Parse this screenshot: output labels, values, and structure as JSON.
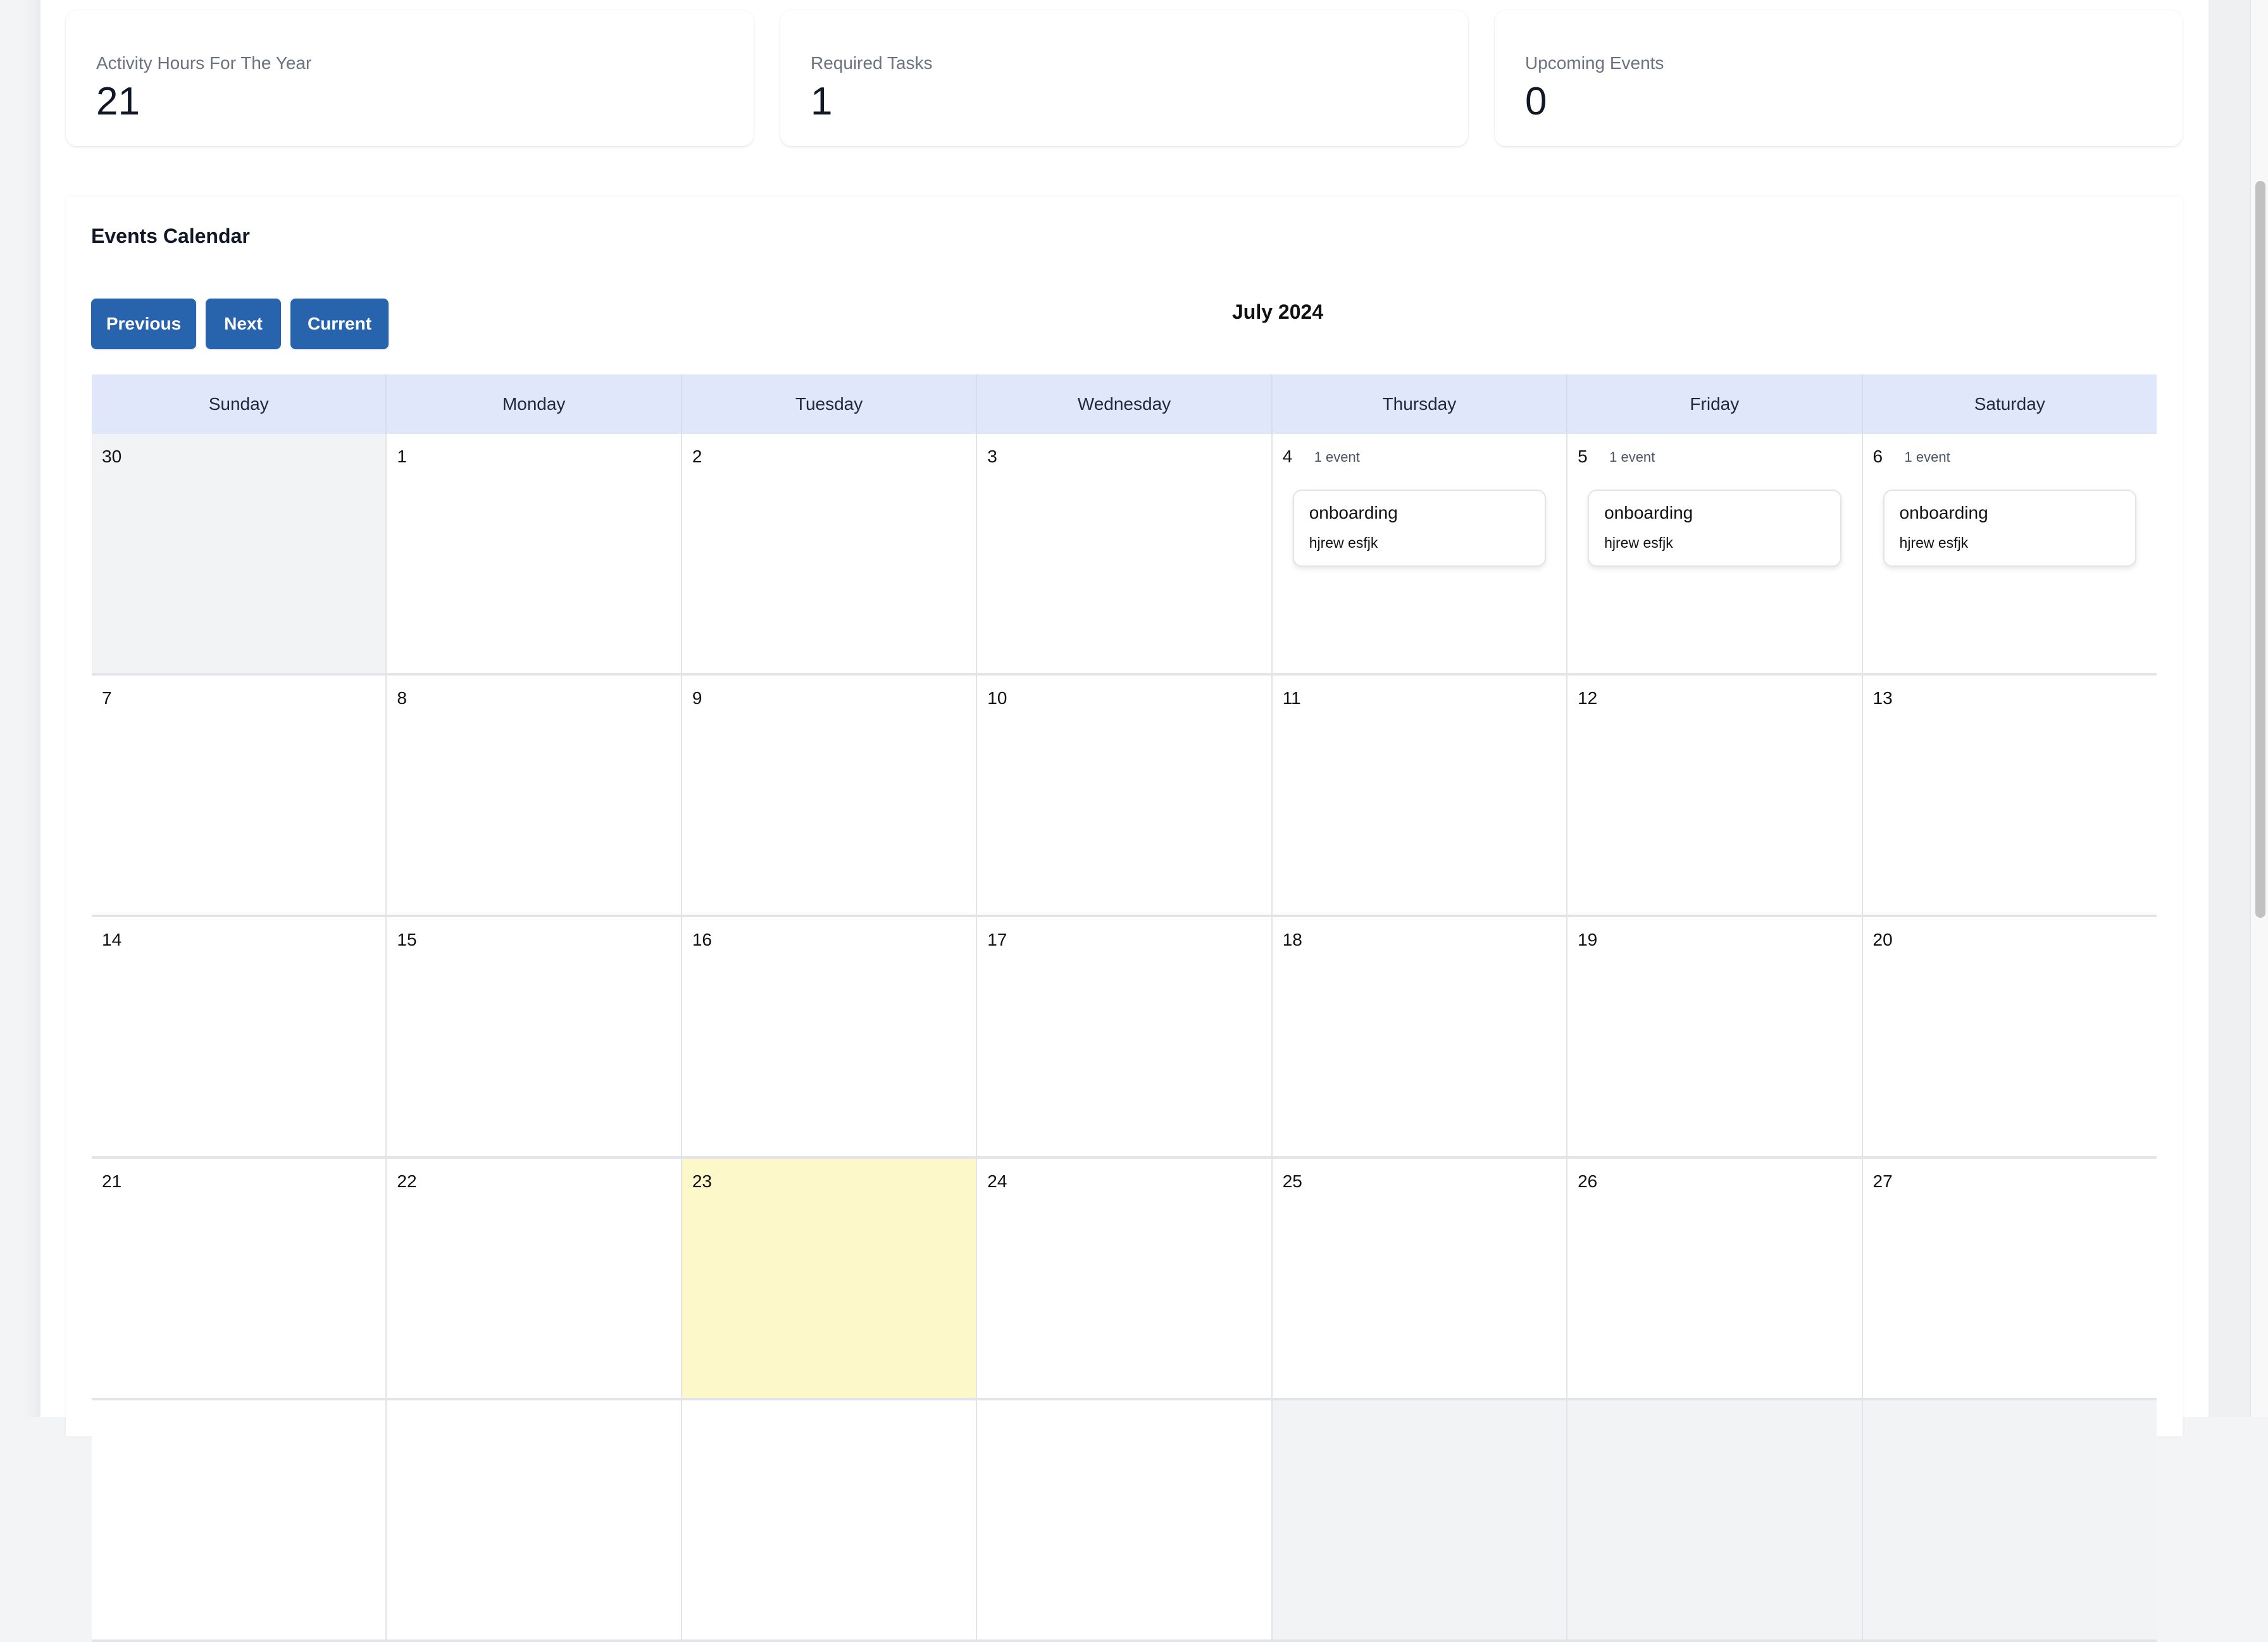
{
  "stats": [
    {
      "label": "Activity Hours For The Year",
      "value": "21"
    },
    {
      "label": "Required Tasks",
      "value": "1"
    },
    {
      "label": "Upcoming Events",
      "value": "0"
    }
  ],
  "calendar": {
    "title": "Events Calendar",
    "month_label": "July 2024",
    "buttons": {
      "previous": "Previous",
      "next": "Next",
      "current": "Current"
    },
    "weekdays": [
      "Sunday",
      "Monday",
      "Tuesday",
      "Wednesday",
      "Thursday",
      "Friday",
      "Saturday"
    ],
    "colors": {
      "header_bg": "#e0e7fb",
      "button_bg": "#2863ad",
      "today_bg": "#fcf8c9",
      "other_month_bg": "#f2f3f5"
    },
    "weeks": [
      [
        {
          "day": "30",
          "other": true
        },
        {
          "day": "1"
        },
        {
          "day": "2"
        },
        {
          "day": "3"
        },
        {
          "day": "4",
          "count": "1 event",
          "events": [
            {
              "title": "onboarding",
              "desc": "hjrew esfjk"
            }
          ]
        },
        {
          "day": "5",
          "count": "1 event",
          "events": [
            {
              "title": "onboarding",
              "desc": "hjrew esfjk"
            }
          ]
        },
        {
          "day": "6",
          "count": "1 event",
          "events": [
            {
              "title": "onboarding",
              "desc": "hjrew esfjk"
            }
          ]
        }
      ],
      [
        {
          "day": "7"
        },
        {
          "day": "8"
        },
        {
          "day": "9"
        },
        {
          "day": "10"
        },
        {
          "day": "11"
        },
        {
          "day": "12"
        },
        {
          "day": "13"
        }
      ],
      [
        {
          "day": "14"
        },
        {
          "day": "15"
        },
        {
          "day": "16"
        },
        {
          "day": "17"
        },
        {
          "day": "18"
        },
        {
          "day": "19"
        },
        {
          "day": "20"
        }
      ],
      [
        {
          "day": "21"
        },
        {
          "day": "22"
        },
        {
          "day": "23",
          "today": true
        },
        {
          "day": "24"
        },
        {
          "day": "25"
        },
        {
          "day": "26"
        },
        {
          "day": "27"
        }
      ],
      [
        {
          "day": ""
        },
        {
          "day": ""
        },
        {
          "day": ""
        },
        {
          "day": ""
        },
        {
          "day": "",
          "other": true
        },
        {
          "day": "",
          "other": true
        },
        {
          "day": "",
          "other": true
        }
      ]
    ]
  }
}
